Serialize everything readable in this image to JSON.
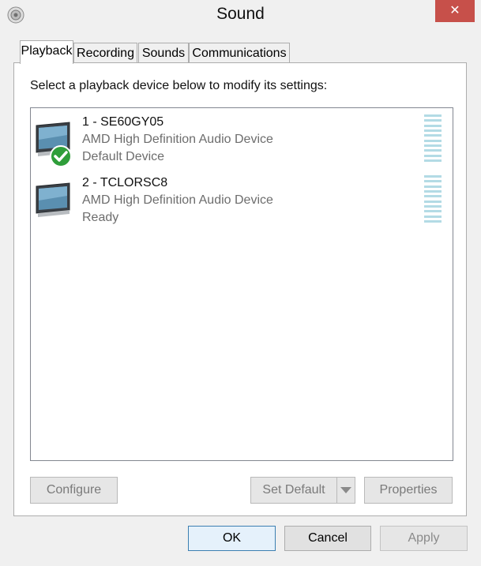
{
  "window": {
    "title": "Sound",
    "close_glyph": "✕",
    "icon": "sound-app-icon"
  },
  "tabs": [
    {
      "label": "Playback",
      "active": true
    },
    {
      "label": "Recording",
      "active": false
    },
    {
      "label": "Sounds",
      "active": false
    },
    {
      "label": "Communications",
      "active": false
    }
  ],
  "playback": {
    "instruction": "Select a playback device below to modify its settings:",
    "devices": [
      {
        "name": "1 - SE60GY05",
        "description": "AMD High Definition Audio Device",
        "status": "Default Device",
        "default": true
      },
      {
        "name": "2 - TCLORSC8",
        "description": "AMD High Definition Audio Device",
        "status": "Ready",
        "default": false
      }
    ],
    "buttons": {
      "configure": "Configure",
      "set_default": "Set Default",
      "properties": "Properties"
    }
  },
  "dialog_buttons": {
    "ok": "OK",
    "cancel": "Cancel",
    "apply": "Apply"
  },
  "colors": {
    "close": "#c7504a",
    "accent_border": "#3c7fb1",
    "meter": "#b3dbe5",
    "check": "#2f9e3a"
  }
}
